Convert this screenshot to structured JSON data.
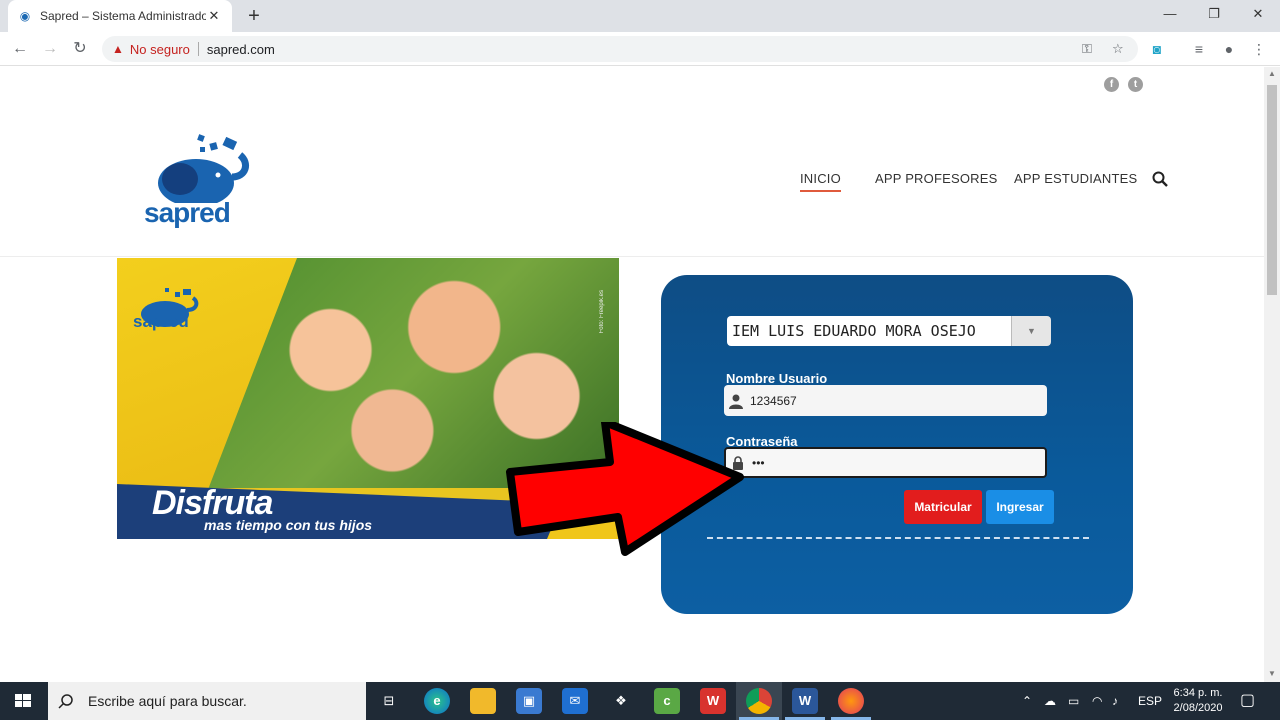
{
  "browser": {
    "tab_title": "Sapred – Sistema Administrador",
    "security_label": "No seguro",
    "url": "sapred.com"
  },
  "site": {
    "logo_text": "sapred",
    "nav": [
      "INICIO",
      "APP PROFESORES",
      "APP ESTUDIANTES"
    ],
    "active_nav": "INICIO"
  },
  "banner": {
    "logo_text": "sapred",
    "headline": "Disfruta",
    "subline": "mas tiempo con tus hijos",
    "credit": "Foto: Freepik.es"
  },
  "login": {
    "institution": "IEM LUIS EDUARDO MORA OSEJO",
    "username_label": "Nombre Usuario",
    "username_value": "1234567",
    "password_label": "Contraseña",
    "password_value": "•••",
    "enroll_button": "Matricular",
    "login_button": "Ingresar",
    "colors": {
      "enroll": "#e21d1d",
      "login": "#1a8ee6"
    }
  },
  "taskbar": {
    "search_placeholder": "Escribe aquí para buscar.",
    "language": "ESP",
    "time": "6:34 p. m.",
    "date": "2/08/2020"
  }
}
